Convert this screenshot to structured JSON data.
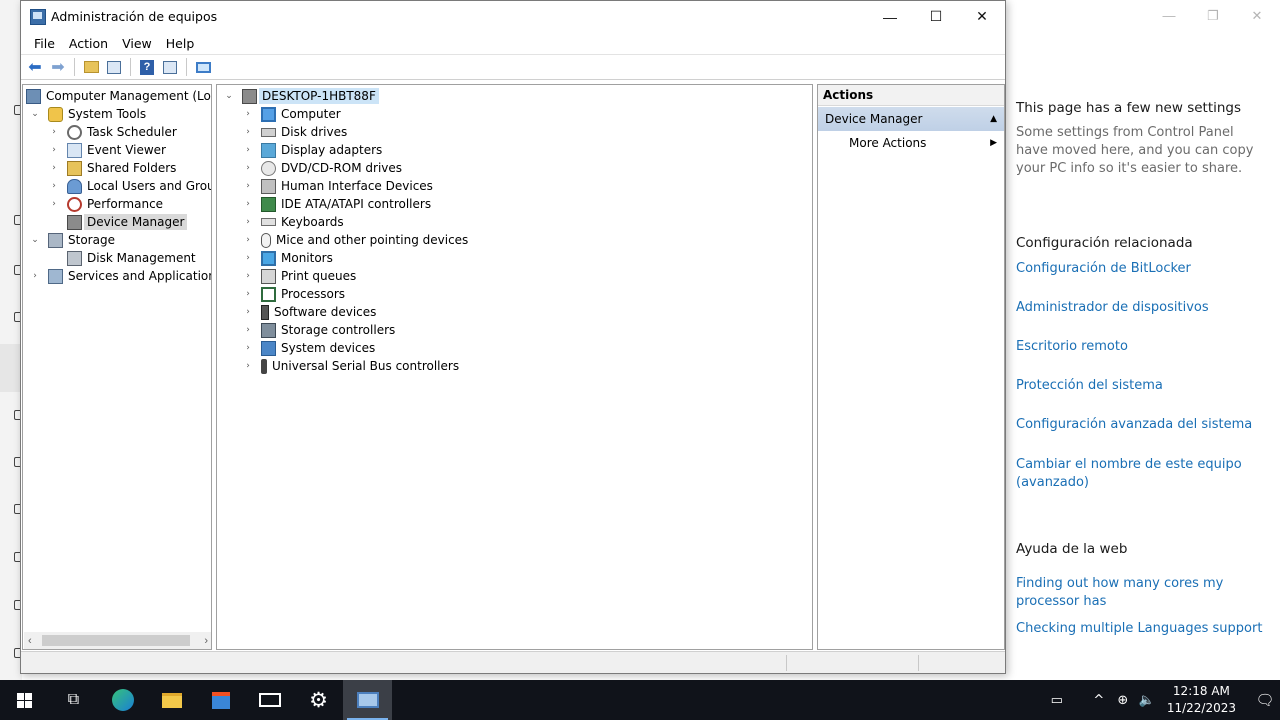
{
  "background_settings": {
    "window_controls": [
      "—",
      "❐",
      "✕"
    ],
    "intro_title": "This page has a few new settings",
    "intro_text": "Some settings from Control Panel have moved here, and you can copy your PC info so it's easier to share.",
    "related_heading": "Configuración relacionada",
    "related_links": [
      "Configuración de BitLocker",
      "Administrador de dispositivos",
      "Escritorio remoto",
      "Protección del sistema",
      "Configuración avanzada del sistema",
      "Cambiar el nombre de este equipo (avanzado)"
    ],
    "web_help_heading": "Ayuda de la web",
    "web_help_links": [
      "Finding out how many cores my processor has",
      "Checking multiple Languages support"
    ]
  },
  "window": {
    "title": "Administración de equipos",
    "controls": {
      "minimize": "—",
      "maximize": "☐",
      "close": "✕"
    },
    "menu": [
      "File",
      "Action",
      "View",
      "Help"
    ],
    "toolbar_icons": [
      "back-arrow-icon",
      "forward-arrow-icon",
      "up-folder-icon",
      "show-hide-tree-icon",
      "help-icon",
      "properties-icon",
      "monitor-icon"
    ]
  },
  "tree": {
    "root": "Computer Management (Local",
    "system_tools": "System Tools",
    "task_scheduler": "Task Scheduler",
    "event_viewer": "Event Viewer",
    "shared_folders": "Shared Folders",
    "local_users_groups": "Local Users and Groups",
    "performance": "Performance",
    "device_manager": "Device Manager",
    "storage": "Storage",
    "disk_management": "Disk Management",
    "services_apps": "Services and Applications",
    "expand_open": "⌄",
    "expand_closed": "›"
  },
  "devices": {
    "computer_name": "DESKTOP-1HBT88F",
    "categories": [
      "Computer",
      "Disk drives",
      "Display adapters",
      "DVD/CD-ROM drives",
      "Human Interface Devices",
      "IDE ATA/ATAPI controllers",
      "Keyboards",
      "Mice and other pointing devices",
      "Monitors",
      "Print queues",
      "Processors",
      "Software devices",
      "Storage controllers",
      "System devices",
      "Universal Serial Bus controllers"
    ]
  },
  "actions": {
    "header": "Actions",
    "section": "Device Manager",
    "section_arrow": "▲",
    "more_actions": "More Actions",
    "more_arrow": "▶"
  },
  "scrollbar": {
    "left": "‹",
    "right": "›"
  },
  "taskbar": {
    "time": "12:18 AM",
    "date": "11/22/2023",
    "tray_up": "^",
    "tray_network": "⊕",
    "tray_volume": "🔈",
    "tray_notification": "🗨",
    "tray_keyboard": "▭"
  }
}
